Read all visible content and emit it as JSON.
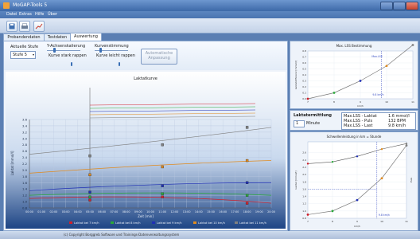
{
  "app": {
    "title": "MoGAP-Tools 5"
  },
  "menu": [
    {
      "label": "Datei"
    },
    {
      "label": "Extras"
    },
    {
      "label": "Hilfe"
    },
    {
      "label": "Über"
    }
  ],
  "toolbar": {
    "buttons": [
      "save-icon",
      "print-icon",
      "chart-icon"
    ]
  },
  "tabs": [
    {
      "label": "Probandendaten"
    },
    {
      "label": "Testdaten"
    },
    {
      "label": "Auswertung",
      "active": true
    }
  ],
  "controls": {
    "stage_label": "Aktuelle Stufe",
    "stage_value": "Stufe 5",
    "smoothing_label": "Y-Achsenskalierung",
    "smoothing_sub": "Kurve stark rappen",
    "fit_label": "Kurvenstimmung",
    "fit_sub": "Kurve leicht rappen",
    "auto_button": "Automatische Anpassung"
  },
  "main_chart": {
    "title": "Laktatkurve",
    "ylabel": "Laktat [mmol/l]",
    "xlabel": "Zeit [min]",
    "y_ticks": [
      "0.8",
      "1.0",
      "1.2",
      "1.4",
      "1.6",
      "1.8",
      "2.0",
      "2.2",
      "2.4",
      "2.6",
      "2.8",
      "3.0",
      "3.2",
      "3.4",
      "3.6"
    ],
    "x_ticks": [
      "00:00",
      "01:00",
      "02:00",
      "03:00",
      "04:00",
      "05:00",
      "06:00",
      "07:00",
      "08:00",
      "09:00",
      "10:00",
      "11:00",
      "12:00",
      "13:00",
      "14:00",
      "15:00",
      "16:00",
      "17:00",
      "18:00",
      "19:00",
      "20:00"
    ],
    "legend": [
      {
        "label": "Laktat bei 7 km/h",
        "color": "#d21f2a"
      },
      {
        "label": "Laktat bei 8 km/h",
        "color": "#2aa83a"
      },
      {
        "label": "Laktat bei 9 km/h",
        "color": "#1f2fb5"
      },
      {
        "label": "Laktat bei 10 km/h",
        "color": "#e08a1e"
      },
      {
        "label": "Laktat bei 11 km/h",
        "color": "#808080"
      }
    ]
  },
  "chart_data": [
    {
      "type": "line",
      "title": "Laktatkurve",
      "xlabel": "Zeit [min]",
      "ylabel": "Laktat [mmol/l]",
      "x": [
        "05:00",
        "11:00",
        "18:00"
      ],
      "ylim": [
        0.8,
        3.6
      ],
      "series": [
        {
          "name": "Laktat bei 7 km/h",
          "values": [
            1.05,
            1.15,
            0.95
          ]
        },
        {
          "name": "Laktat bei 8 km/h",
          "values": [
            1.15,
            1.25,
            1.2
          ]
        },
        {
          "name": "Laktat bei 9 km/h",
          "values": [
            1.3,
            1.5,
            1.6
          ]
        },
        {
          "name": "Laktat bei 10 km/h",
          "values": [
            1.85,
            2.1,
            2.3
          ]
        },
        {
          "name": "Laktat bei 11 km/h",
          "values": [
            2.45,
            2.8,
            3.35
          ]
        }
      ]
    },
    {
      "type": "line",
      "title": "Max. LSS Bestimmung",
      "ylabel": "Laktatdifferenz [mmol/l]",
      "xlabel": "km/h",
      "x": [
        7,
        8,
        9,
        10,
        11
      ],
      "series": [
        {
          "name": "",
          "values": [
            0,
            0.1,
            0.3,
            0.55,
            0.9
          ]
        }
      ]
    },
    {
      "type": "line",
      "title": "Schwellenleistung in km = Stunde",
      "ylabel": "Laktat [mmol/l]",
      "xlabel": "km/h",
      "x": [
        7,
        8,
        9,
        10,
        11
      ],
      "series": [
        {
          "name": "Laktat",
          "values": [
            0.9,
            1.0,
            1.3,
            1.9,
            2.8
          ]
        },
        {
          "name": "Puls",
          "values": [
            2.3,
            2.35,
            2.5,
            2.7,
            2.85
          ]
        }
      ]
    }
  ],
  "lss_panel": {
    "title": "Max. LSS Bestimmung",
    "ylabel": "Laktatdifferenz [mmol/l]",
    "xlabel": "km/h",
    "x_ticks": [
      "7",
      "8",
      "9",
      "10",
      "11"
    ],
    "y_ticks": [
      "0.0",
      "0.1",
      "0.2",
      "0.3",
      "0.4",
      "0.5",
      "0.6",
      "0.7",
      "0.8"
    ],
    "annotation_max": "Max.LSS",
    "annotation_speed": "9.8 km/h"
  },
  "info": {
    "label": "Laktatermittlung",
    "spin_value": "1",
    "spin_unit": "Minute",
    "row1": "Max.LSS - Laktat",
    "row1_val": "1.6 mmol/l",
    "row2": "Max.LSS - Puls",
    "row2_val": "132 BPM",
    "row3": "Max.LSS - Last",
    "row3_val": "9.8 km/h"
  },
  "threshold_panel": {
    "title": "Schwellenleistung in km = Stunde",
    "ylabel": "Laktat [mmol/l]",
    "xlabel": "km/h",
    "y_ticks": [
      "0.8",
      "1.0",
      "1.2",
      "1.4",
      "1.6",
      "1.8",
      "2.0",
      "2.2",
      "2.4",
      "2.6"
    ],
    "x_ticks": [
      "7",
      "8",
      "9",
      "10",
      "11"
    ],
    "annotation": "9.8 km/h",
    "ylabel_right": "Puls"
  },
  "status": {
    "text": "(c) Copyright Borggreb Software und Trainings-Datenverwaltungssystem"
  }
}
